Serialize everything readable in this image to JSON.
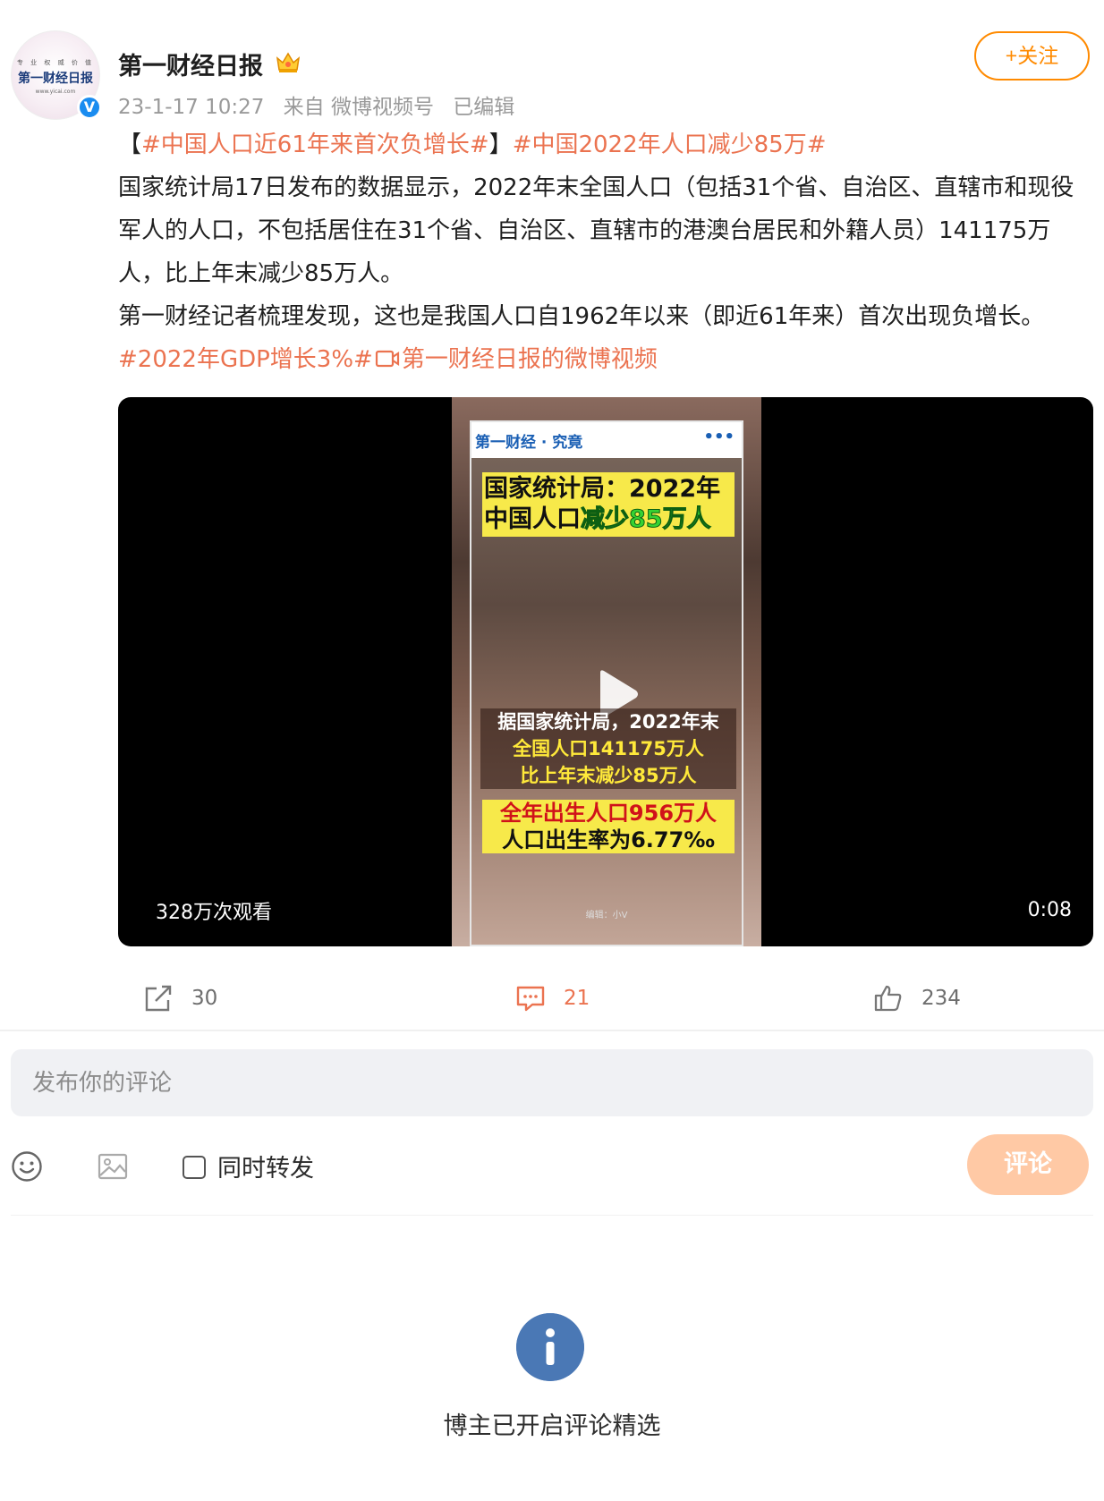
{
  "post": {
    "account_name": "第一财经日报",
    "avatar_top": "专 业 权 威 价 值",
    "avatar_text": "第一财经日报",
    "avatar_url": "www.yicai.com",
    "verified_mark": "V",
    "timestamp": "23-1-17 10:27",
    "source": "来自 微博视频号",
    "edited": "已编辑",
    "follow_label": "+关注",
    "bracket_open": "【",
    "tag1": "#中国人口近61年来首次负增长#",
    "bracket_close": "】",
    "tag2": "#中国2022年人口减少85万#",
    "para1": "国家统计局17日发布的数据显示，2022年末全国人口（包括31个省、自治区、直辖市和现役军人的人口，不包括居住在31个省、自治区、直辖市的港澳台居民和外籍人员）141175万人，比上年末减少85万人。",
    "para2": "第一财经记者梳理发现，这也是我国人口自1962年以来（即近61年来）首次出现负增长。 ",
    "tag3": "#2022年GDP增长3%#",
    "video_link": "第一财经日报的微博视频"
  },
  "video": {
    "card_logo": "第一财经 · 究竟",
    "card_menu": "•••",
    "title_line1": "国家统计局：2022年",
    "title_line2a": "中国人口",
    "title_line2b": "减少85万人",
    "caption1_line1": "据国家统计局，2022年末",
    "caption1_line2": "全国人口141175万人",
    "caption1_line3": "比上年末减少85万人",
    "caption2_line1": "全年出生人口956万人",
    "caption2_line2": "人口出生率为6.77‰",
    "editor": "编辑：小V",
    "views": "328万次观看",
    "duration": "0:08"
  },
  "actions": {
    "repost_count": "30",
    "comment_count": "21",
    "like_count": "234"
  },
  "composer": {
    "placeholder": "发布你的评论",
    "repost_label": "同时转发",
    "submit_label": "评论"
  },
  "notice": {
    "text": "博主已开启评论精选"
  },
  "colors": {
    "accent": "#eb7350",
    "follow": "#ff8a00",
    "submit_disabled": "#ffc9a5",
    "notice_icon": "#4a78b5"
  },
  "icons": [
    "crown-icon",
    "verified-icon",
    "play-icon",
    "video-icon",
    "repost-icon",
    "comment-icon",
    "like-icon",
    "emoji-icon",
    "image-icon",
    "info-icon"
  ]
}
